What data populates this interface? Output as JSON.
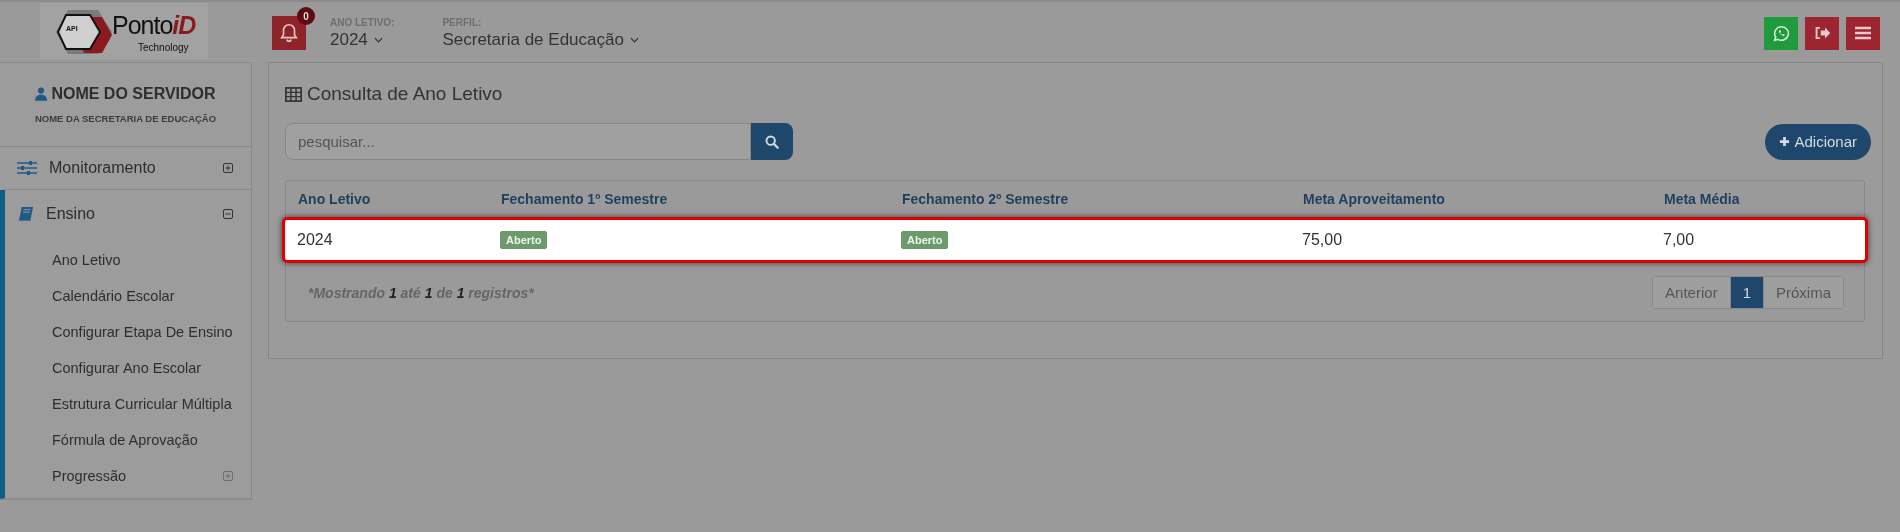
{
  "logo": {
    "badge": "API",
    "name": "Ponto",
    "name_accent": "iD",
    "tagline": "Technology"
  },
  "header": {
    "notifications": {
      "count": "0"
    },
    "selectors": [
      {
        "label": "ANO LETIVO:",
        "value": "2024"
      },
      {
        "label": "PERFIL:",
        "value": "Secretaria de Educação"
      }
    ],
    "actions": [
      {
        "kind": "whatsapp"
      },
      {
        "kind": "logout"
      },
      {
        "kind": "menu"
      }
    ]
  },
  "sidebar": {
    "user": {
      "name": "NOME DO SERVIDOR",
      "department": "NOME DA SECRETARIA DE EDUCAÇÃO"
    },
    "items": [
      {
        "label": "Monitoramento",
        "expanded": false,
        "selected": false
      },
      {
        "label": "Ensino",
        "expanded": true,
        "selected": true,
        "children": [
          {
            "label": "Ano Letivo",
            "kind": "link"
          },
          {
            "label": "Calendário Escolar",
            "kind": "link"
          },
          {
            "label": "Configurar Etapa De Ensino",
            "kind": "link"
          },
          {
            "label": "Configurar Ano Escolar",
            "kind": "link"
          },
          {
            "label": "Estrutura Curricular Múltipla",
            "kind": "link"
          },
          {
            "label": "Fórmula de Aprovação",
            "kind": "link"
          },
          {
            "label": "Progressão",
            "kind": "group",
            "expanded": false
          }
        ]
      }
    ]
  },
  "page": {
    "title": "Consulta de Ano Letivo",
    "search": {
      "placeholder": "pesquisar..."
    },
    "add_button": "Adicionar",
    "table": {
      "columns": [
        "Ano Letivo",
        "Fechamento 1º Semestre",
        "Fechamento 2º Semestre",
        "Meta Aproveitamento",
        "Meta Média"
      ],
      "rows": [
        {
          "selected": true,
          "cells": [
            {
              "kind": "text",
              "text": "2024"
            },
            {
              "kind": "badge",
              "text": "Aberto"
            },
            {
              "kind": "badge",
              "text": "Aberto"
            },
            {
              "kind": "text",
              "text": "75,00"
            },
            {
              "kind": "text",
              "text": "7,00"
            }
          ]
        }
      ]
    },
    "summary": "*Mostrando **1** até **1** de **1** registros*",
    "pagination": [
      {
        "label": "Anterior",
        "selected": false
      },
      {
        "label": "1",
        "selected": true
      },
      {
        "label": "Próxima",
        "selected": false
      }
    ]
  }
}
